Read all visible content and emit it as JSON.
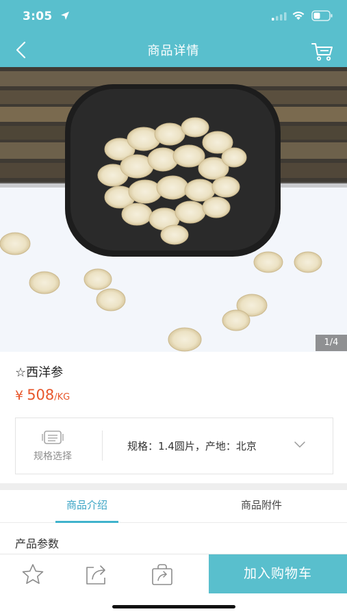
{
  "status_bar": {
    "time": "3:05",
    "location_icon": "location-arrow-icon",
    "signal_icon": "cellular-signal-icon",
    "wifi_icon": "wifi-icon",
    "battery_icon": "battery-icon"
  },
  "nav": {
    "back_icon": "chevron-left-icon",
    "title": "商品详情",
    "cart_icon": "shopping-cart-icon"
  },
  "gallery": {
    "counter": "1/4"
  },
  "product": {
    "name": "☆西洋参",
    "price_symbol": "¥",
    "price": "508",
    "price_unit": "/KG"
  },
  "spec": {
    "select_label": "规格选择",
    "select_icon": "spec-list-icon",
    "summary": "规格：1.4圆片，产地：北京",
    "expand_icon": "chevron-down-icon"
  },
  "tabs": [
    {
      "label": "商品介绍",
      "active": true
    },
    {
      "label": "商品附件",
      "active": false
    }
  ],
  "section": {
    "title": "产品参数"
  },
  "bottom_bar": {
    "favorite_icon": "star-icon",
    "share_icon": "share-icon",
    "store_icon": "bag-share-icon",
    "add_to_cart": "加入购物车"
  },
  "colors": {
    "accent": "#59bfcd",
    "price": "#e8572c",
    "tab_active": "#3aa4c5"
  }
}
